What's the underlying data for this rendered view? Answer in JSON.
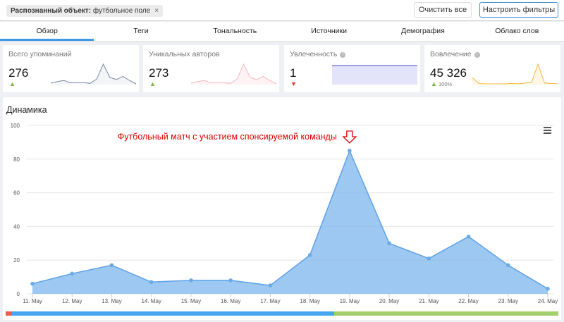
{
  "filter": {
    "label": "Распознанный объект:",
    "value": "футбольное поле",
    "remove": "×"
  },
  "buttons": {
    "clear": "Очистить все",
    "configure": "Настроить фильтры"
  },
  "tabs": [
    {
      "label": "Обзор",
      "active": true
    },
    {
      "label": "Теги"
    },
    {
      "label": "Тональность"
    },
    {
      "label": "Источники"
    },
    {
      "label": "Демография"
    },
    {
      "label": "Облако слов"
    }
  ],
  "cards": [
    {
      "title": "Всего упоминаний",
      "value": "276",
      "trend": "up",
      "color": "#7a8aa0",
      "fill": "#f3f5f8",
      "spark": [
        6,
        12,
        17,
        7,
        8,
        8,
        5,
        23,
        85,
        30,
        21,
        34,
        17,
        3
      ]
    },
    {
      "title": "Уникальных авторов",
      "value": "273",
      "trend": "up",
      "color": "#f7b8c0",
      "fill": "#fff3f5",
      "spark": [
        6,
        12,
        17,
        7,
        8,
        8,
        5,
        23,
        85,
        30,
        21,
        34,
        17,
        3
      ]
    },
    {
      "title": "Увлеченность",
      "value": "1",
      "trend": "down",
      "info": true,
      "color": "#4b4bc8",
      "fill": "#e3e3fa",
      "spark": [
        1,
        1,
        1,
        1,
        1,
        1,
        1,
        1,
        1,
        1,
        1,
        1,
        1,
        1
      ]
    },
    {
      "title": "Вовлечение",
      "value": "45 326",
      "trend": "up",
      "change": "100%",
      "info": true,
      "color": "#f5b942",
      "fill": "#fff6e3",
      "spark": [
        40,
        5,
        3,
        3,
        3,
        3,
        5,
        3,
        8,
        10,
        120,
        8,
        5,
        4
      ]
    }
  ],
  "colors": {
    "up": "#7cb342",
    "down": "#e53935",
    "accent": "#3d9ae8",
    "annotation": "#e00000"
  },
  "chart_data": {
    "type": "area",
    "title": "Динамика",
    "categories": [
      "11. May",
      "12. May",
      "13. May",
      "14. May",
      "15. May",
      "16. May",
      "17. May",
      "18. May",
      "19. May",
      "20. May",
      "21. May",
      "22. May",
      "23. May",
      "24. May"
    ],
    "values": [
      6,
      12,
      17,
      7,
      8,
      8,
      5,
      23,
      85,
      30,
      21,
      34,
      17,
      3
    ],
    "ylim": [
      0,
      100
    ],
    "yticks": [
      0,
      20,
      40,
      60,
      80,
      100
    ],
    "grid": true,
    "color": "#7cb5ec",
    "annotation": {
      "text": "Футбольный матч с участием спонсируемой команды",
      "category": "19. May"
    },
    "sentiment_bar": [
      {
        "color": "#f15c4a",
        "share": 1.1
      },
      {
        "color": "#45a5f0",
        "share": 58.4
      },
      {
        "color": "#a3cf6a",
        "share": 40.5
      }
    ]
  }
}
